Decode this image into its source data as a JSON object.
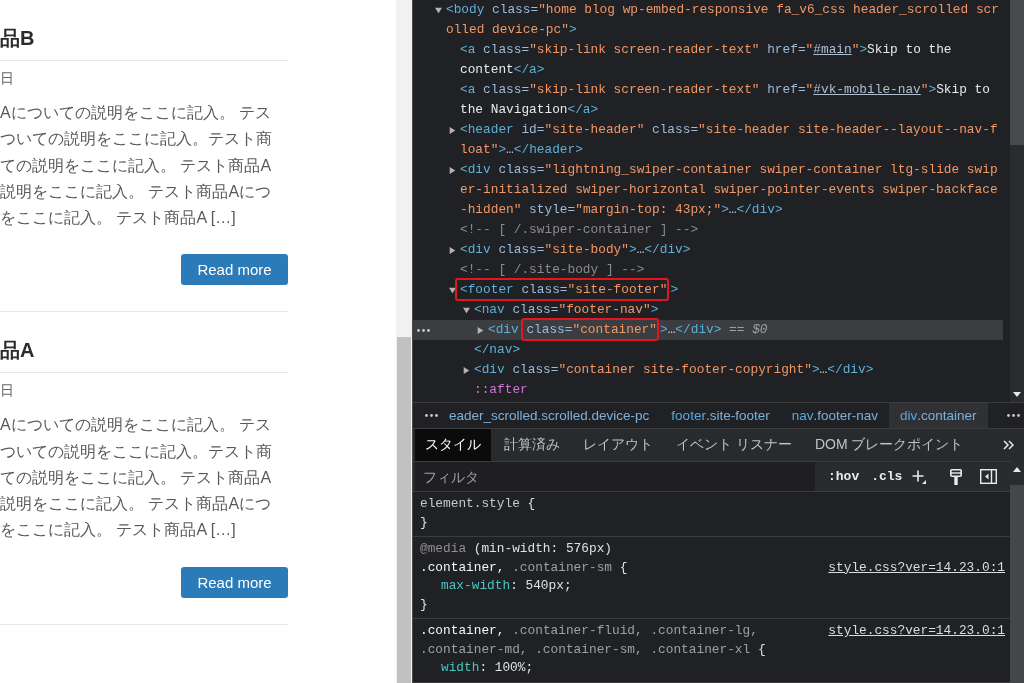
{
  "page": {
    "posts": [
      {
        "title": "品B",
        "date": "日",
        "excerpt_lines": [
          "Aについての説明をここに記入。 テス",
          "ついての説明をここに記入。テスト商",
          "ての説明をここに記入。 テスト商品A",
          "説明をここに記入。 テスト商品Aにつ",
          "をここに記入。 テスト商品A […]"
        ],
        "button": "Read more"
      },
      {
        "title": "品A",
        "date": "日",
        "excerpt_lines": [
          "Aについての説明をここに記入。 テス",
          "ついての説明をここに記入。テスト商",
          "ての説明をここに記入。 テスト商品A",
          "説明をここに記入。 テスト商品Aにつ",
          "をここに記入。 テスト商品A […]"
        ],
        "button": "Read more"
      }
    ]
  },
  "elements_tree": {
    "nodes": [
      {
        "kind": "element",
        "expanded": true,
        "selected": false,
        "tokens": [
          {
            "kind": "tag",
            "text": "<body"
          },
          {
            "kind": "attr",
            "text": " class="
          },
          {
            "kind": "value",
            "text": "\"home blog wp-embed-responsive fa_v6_css header_scrolled scrolled device-pc\""
          },
          {
            "kind": "tag",
            "text": ">"
          }
        ],
        "children": [
          {
            "kind": "leaf",
            "selected": false,
            "tokens": [
              {
                "kind": "tag",
                "text": "<a"
              },
              {
                "kind": "attr",
                "text": " class="
              },
              {
                "kind": "value",
                "text": "\"skip-link screen-reader-text\""
              },
              {
                "kind": "attr",
                "text": " href="
              },
              {
                "kind": "value",
                "text": "\""
              },
              {
                "kind": "link",
                "text": "#main"
              },
              {
                "kind": "value",
                "text": "\""
              },
              {
                "kind": "tag",
                "text": ">"
              },
              {
                "kind": "text",
                "text": "Skip to the content"
              },
              {
                "kind": "tag",
                "text": "</a>"
              }
            ]
          },
          {
            "kind": "leaf",
            "selected": false,
            "tokens": [
              {
                "kind": "tag",
                "text": "<a"
              },
              {
                "kind": "attr",
                "text": " class="
              },
              {
                "kind": "value",
                "text": "\"skip-link screen-reader-text\""
              },
              {
                "kind": "attr",
                "text": " href="
              },
              {
                "kind": "value",
                "text": "\""
              },
              {
                "kind": "link",
                "text": "#vk-mobile-nav"
              },
              {
                "kind": "value",
                "text": "\""
              },
              {
                "kind": "tag",
                "text": ">"
              },
              {
                "kind": "text",
                "text": "Skip to the Navigation"
              },
              {
                "kind": "tag",
                "text": "</a>"
              }
            ]
          },
          {
            "kind": "element",
            "expanded": false,
            "selected": false,
            "tokens": [
              {
                "kind": "tag",
                "text": "<header"
              },
              {
                "kind": "attr",
                "text": " id="
              },
              {
                "kind": "value",
                "text": "\"site-header\""
              },
              {
                "kind": "attr",
                "text": " class="
              },
              {
                "kind": "value",
                "text": "\"site-header site-header--layout--nav-float\""
              },
              {
                "kind": "tag",
                "text": ">"
              },
              {
                "kind": "ellipsis",
                "text": "…"
              },
              {
                "kind": "tag",
                "text": "</header>"
              }
            ]
          },
          {
            "kind": "element",
            "expanded": false,
            "selected": false,
            "tokens": [
              {
                "kind": "tag",
                "text": "<div"
              },
              {
                "kind": "attr",
                "text": " class="
              },
              {
                "kind": "value",
                "text": "\"lightning_swiper-container swiper-container ltg-slide swiper-initialized swiper-horizontal swiper-pointer-events swiper-backface-hidden\""
              },
              {
                "kind": "attr",
                "text": " style="
              },
              {
                "kind": "value",
                "text": "\"margin-top: 43px;\""
              },
              {
                "kind": "tag",
                "text": ">"
              },
              {
                "kind": "ellipsis",
                "text": "…"
              },
              {
                "kind": "tag",
                "text": "</div>"
              }
            ]
          },
          {
            "kind": "leaf",
            "selected": false,
            "tokens": [
              {
                "kind": "comment",
                "text": "<!-- [ /.swiper-container ] -->"
              }
            ]
          },
          {
            "kind": "element",
            "expanded": false,
            "selected": false,
            "tokens": [
              {
                "kind": "tag",
                "text": "<div"
              },
              {
                "kind": "attr",
                "text": " class="
              },
              {
                "kind": "value",
                "text": "\"site-body\""
              },
              {
                "kind": "tag",
                "text": ">"
              },
              {
                "kind": "ellipsis",
                "text": "…"
              },
              {
                "kind": "tag",
                "text": "</div>"
              }
            ]
          },
          {
            "kind": "leaf",
            "selected": false,
            "tokens": [
              {
                "kind": "comment",
                "text": "<!-- [ /.site-body ] -->"
              }
            ]
          },
          {
            "kind": "element",
            "expanded": true,
            "selected": false,
            "tokens": [
              {
                "kind": "box",
                "tokens": [
                  {
                    "kind": "tag",
                    "text": "<footer"
                  },
                  {
                    "kind": "attr",
                    "text": " class="
                  },
                  {
                    "kind": "value",
                    "text": "\"site-footer\""
                  }
                ]
              },
              {
                "kind": "tag",
                "text": ">"
              }
            ],
            "children": [
              {
                "kind": "element",
                "expanded": true,
                "selected": false,
                "tokens": [
                  {
                    "kind": "tag",
                    "text": "<nav"
                  },
                  {
                    "kind": "attr",
                    "text": " class="
                  },
                  {
                    "kind": "value",
                    "text": "\"footer-nav\""
                  },
                  {
                    "kind": "tag",
                    "text": ">"
                  }
                ],
                "children": [
                  {
                    "kind": "element",
                    "expanded": false,
                    "selected": true,
                    "tokens": [
                      {
                        "kind": "tag",
                        "text": "<div "
                      },
                      {
                        "kind": "box",
                        "tokens": [
                          {
                            "kind": "attr",
                            "text": "class="
                          },
                          {
                            "kind": "value",
                            "text": "\"container\""
                          }
                        ]
                      },
                      {
                        "kind": "tag",
                        "text": ">"
                      },
                      {
                        "kind": "ellipsis",
                        "text": "…"
                      },
                      {
                        "kind": "tag",
                        "text": "</div>"
                      },
                      {
                        "kind": "hint",
                        "text": " == $0"
                      }
                    ]
                  }
                ],
                "closing_tokens": [
                  {
                    "kind": "tag",
                    "text": "</nav>"
                  }
                ]
              },
              {
                "kind": "element",
                "expanded": false,
                "selected": false,
                "tokens": [
                  {
                    "kind": "tag",
                    "text": "<div"
                  },
                  {
                    "kind": "attr",
                    "text": " class="
                  },
                  {
                    "kind": "value",
                    "text": "\"container site-footer-copyright\""
                  },
                  {
                    "kind": "tag",
                    "text": ">"
                  },
                  {
                    "kind": "ellipsis",
                    "text": "…"
                  },
                  {
                    "kind": "tag",
                    "text": "</div>"
                  }
                ]
              },
              {
                "kind": "leaf",
                "selected": false,
                "tokens": [
                  {
                    "kind": "pseudo",
                    "text": "::after"
                  }
                ]
              }
            ]
          }
        ]
      }
    ]
  },
  "breadcrumbs": {
    "items": [
      {
        "classes": "eader_scrolled.scrolled.device-pc",
        "selected": false
      },
      {
        "tag": "footer",
        "classes": ".site-footer",
        "selected": false
      },
      {
        "tag": "nav",
        "classes": ".footer-nav",
        "selected": false
      },
      {
        "tag": "div",
        "classes": ".container",
        "selected": true
      }
    ]
  },
  "styles_tabs": {
    "tabs": [
      {
        "label": "スタイル",
        "selected": true
      },
      {
        "label": "計算済み",
        "selected": false
      },
      {
        "label": "レイアウト",
        "selected": false
      },
      {
        "label": "イベント リスナー",
        "selected": false
      },
      {
        "label": "DOM ブレークポイント",
        "selected": false
      }
    ]
  },
  "styles_toolbar": {
    "filter": {
      "placeholder": "フィルタ"
    },
    "buttons": [
      {
        "kind": "text",
        "label": ":hov"
      },
      {
        "kind": "text",
        "label": ".cls"
      },
      {
        "kind": "plus"
      },
      {
        "kind": "brush"
      },
      {
        "kind": "sidebar"
      }
    ]
  },
  "styles": {
    "rules": [
      {
        "lines": [
          {
            "kind": "selector",
            "tokens": [
              {
                "kind": "inline",
                "text": "element.style"
              },
              {
                "kind": "plain",
                "text": " {"
              }
            ]
          },
          {
            "kind": "close",
            "tokens": [
              {
                "kind": "plain",
                "text": "}"
              }
            ]
          }
        ]
      },
      {
        "source": "style.css?ver=14.23.0:1",
        "lines": [
          {
            "kind": "media",
            "tokens": [
              {
                "kind": "at",
                "text": "@media"
              },
              {
                "kind": "plain",
                "text": " (min-width: 576px)"
              }
            ]
          },
          {
            "kind": "selector",
            "tokens": [
              {
                "kind": "selector",
                "text": ".container,"
              },
              {
                "kind": "unmatched",
                "text": " .container-sm"
              },
              {
                "kind": "plain",
                "text": " {"
              }
            ]
          },
          {
            "kind": "declaration",
            "tokens": [
              {
                "kind": "property",
                "text": "max-width"
              },
              {
                "kind": "plain",
                "text": ": 540px;"
              }
            ]
          },
          {
            "kind": "close",
            "tokens": [
              {
                "kind": "plain",
                "text": "}"
              }
            ]
          }
        ]
      },
      {
        "source": "style.css?ver=14.23.0:1",
        "lines": [
          {
            "kind": "selector",
            "tokens": [
              {
                "kind": "selector",
                "text": ".container,"
              },
              {
                "kind": "unmatched",
                "text": " .container-fluid, .container-lg, .container-md, .container-sm, .container-xl"
              },
              {
                "kind": "plain",
                "text": " {"
              }
            ]
          },
          {
            "kind": "declaration",
            "tokens": [
              {
                "kind": "property",
                "text": "width"
              },
              {
                "kind": "plain",
                "text": ": 100%;"
              }
            ]
          }
        ]
      }
    ]
  }
}
